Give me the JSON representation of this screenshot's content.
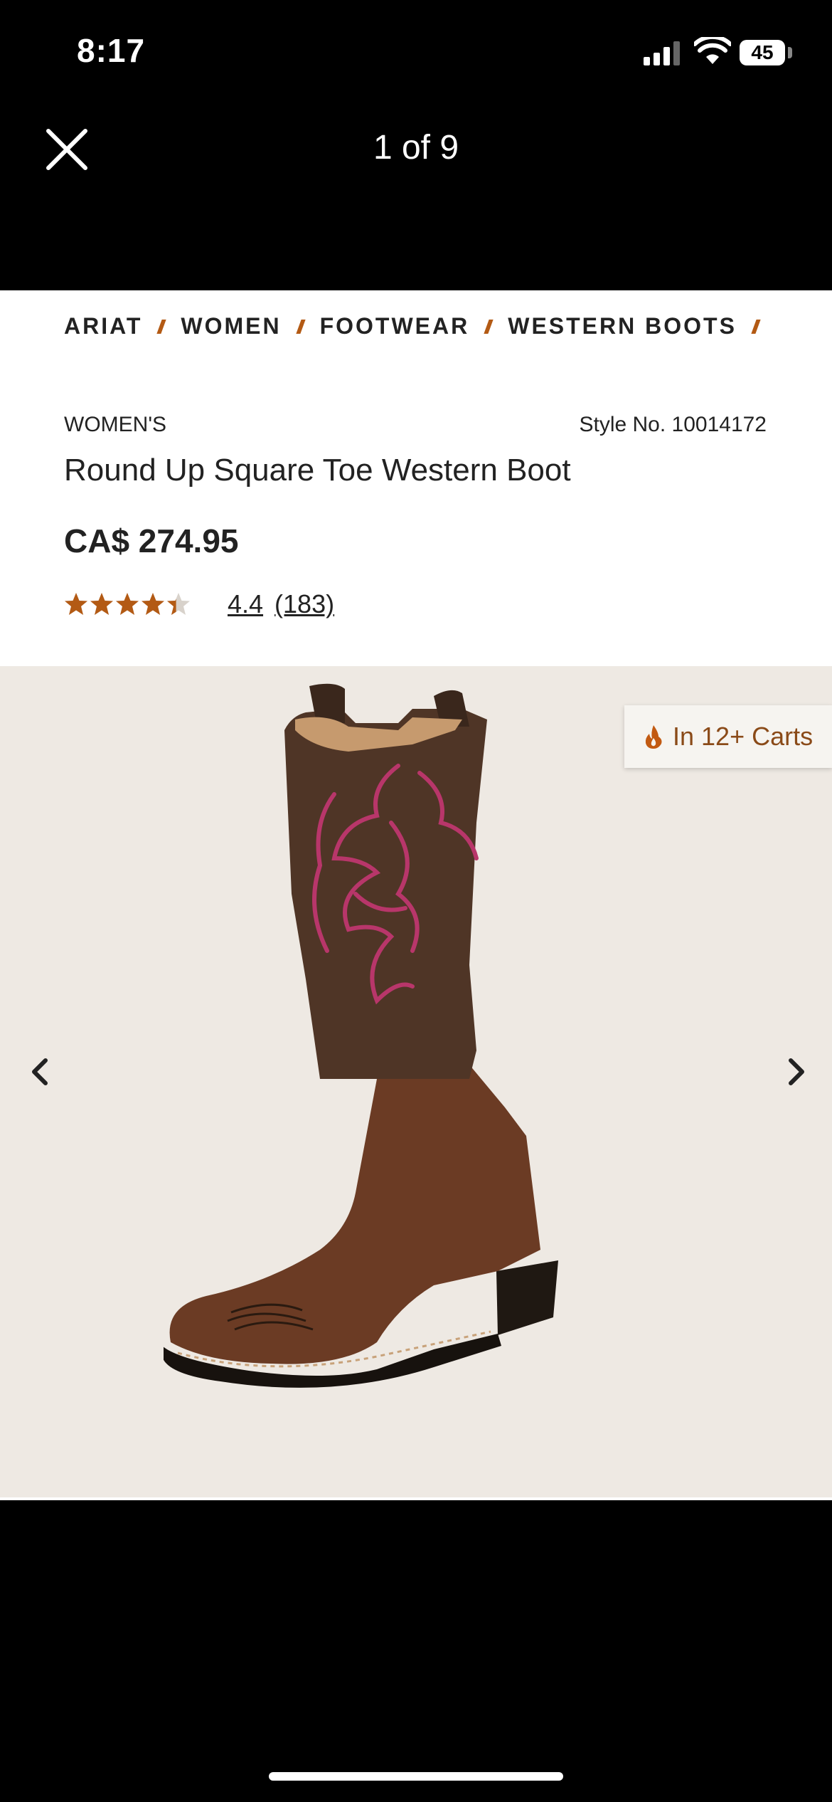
{
  "status_bar": {
    "time": "8:17",
    "battery": "45",
    "icons": [
      "signal-icon",
      "wifi-icon",
      "battery-icon"
    ]
  },
  "viewer": {
    "close_icon": "close-icon",
    "counter": "1 of 9"
  },
  "breadcrumb": [
    "ARIAT",
    "WOMEN",
    "FOOTWEAR",
    "WESTERN BOOTS"
  ],
  "product": {
    "category": "WOMEN'S",
    "style_no": "Style No. 10014172",
    "title": "Round Up Square Toe Western Boot",
    "price": "CA$ 274.95",
    "rating": "4.4",
    "rating_stars": 4.4,
    "review_count": "(183)"
  },
  "gallery": {
    "cart_badge": "In 12+ Carts",
    "current_image": 1,
    "total_images": 9
  },
  "colors": {
    "accent": "#b35a14",
    "badge_text": "#8a4a18",
    "gallery_bg": "#eee9e3"
  }
}
